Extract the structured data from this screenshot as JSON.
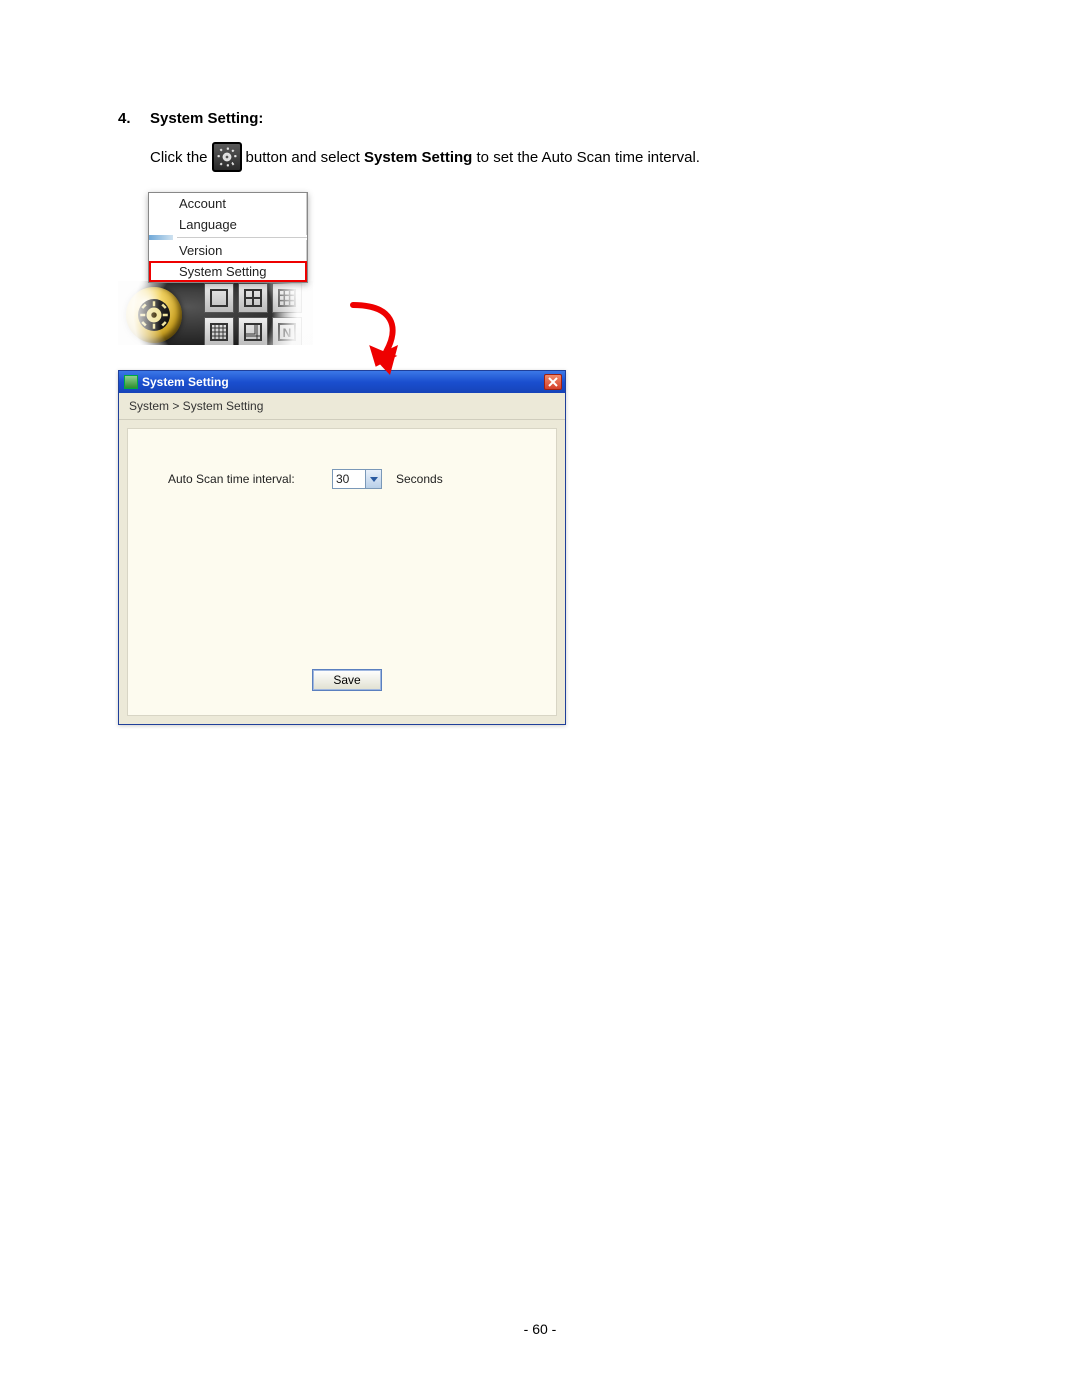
{
  "heading": {
    "number": "4.",
    "title": "System Setting:"
  },
  "instruction": {
    "pre": "Click the",
    "mid": "button and select",
    "bold": "System Setting",
    "post": "to set the Auto Scan time interval."
  },
  "menu": {
    "items": [
      "Account",
      "Language",
      "Version",
      "System Setting"
    ]
  },
  "dialog": {
    "title": "System Setting",
    "breadcrumb": "System > System Setting",
    "field_label": "Auto Scan time interval:",
    "field_value": "30",
    "units": "Seconds",
    "save": "Save"
  },
  "page_number": "- 60 -"
}
